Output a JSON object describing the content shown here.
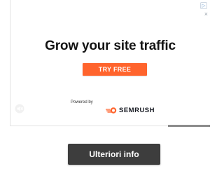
{
  "ad": {
    "headline": "Grow your site traffic",
    "cta_label": "TRY FREE",
    "powered_by": "Powered by",
    "brand_name": "SEMRUSH",
    "brand_color": "#ff642d",
    "adchoices_icon": "adchoices-icon",
    "close_glyph": "×"
  },
  "video": {
    "volume_icon": "volume-muted-icon",
    "progress_fraction": 0.21
  },
  "footer": {
    "more_info_label": "Ulteriori info"
  }
}
